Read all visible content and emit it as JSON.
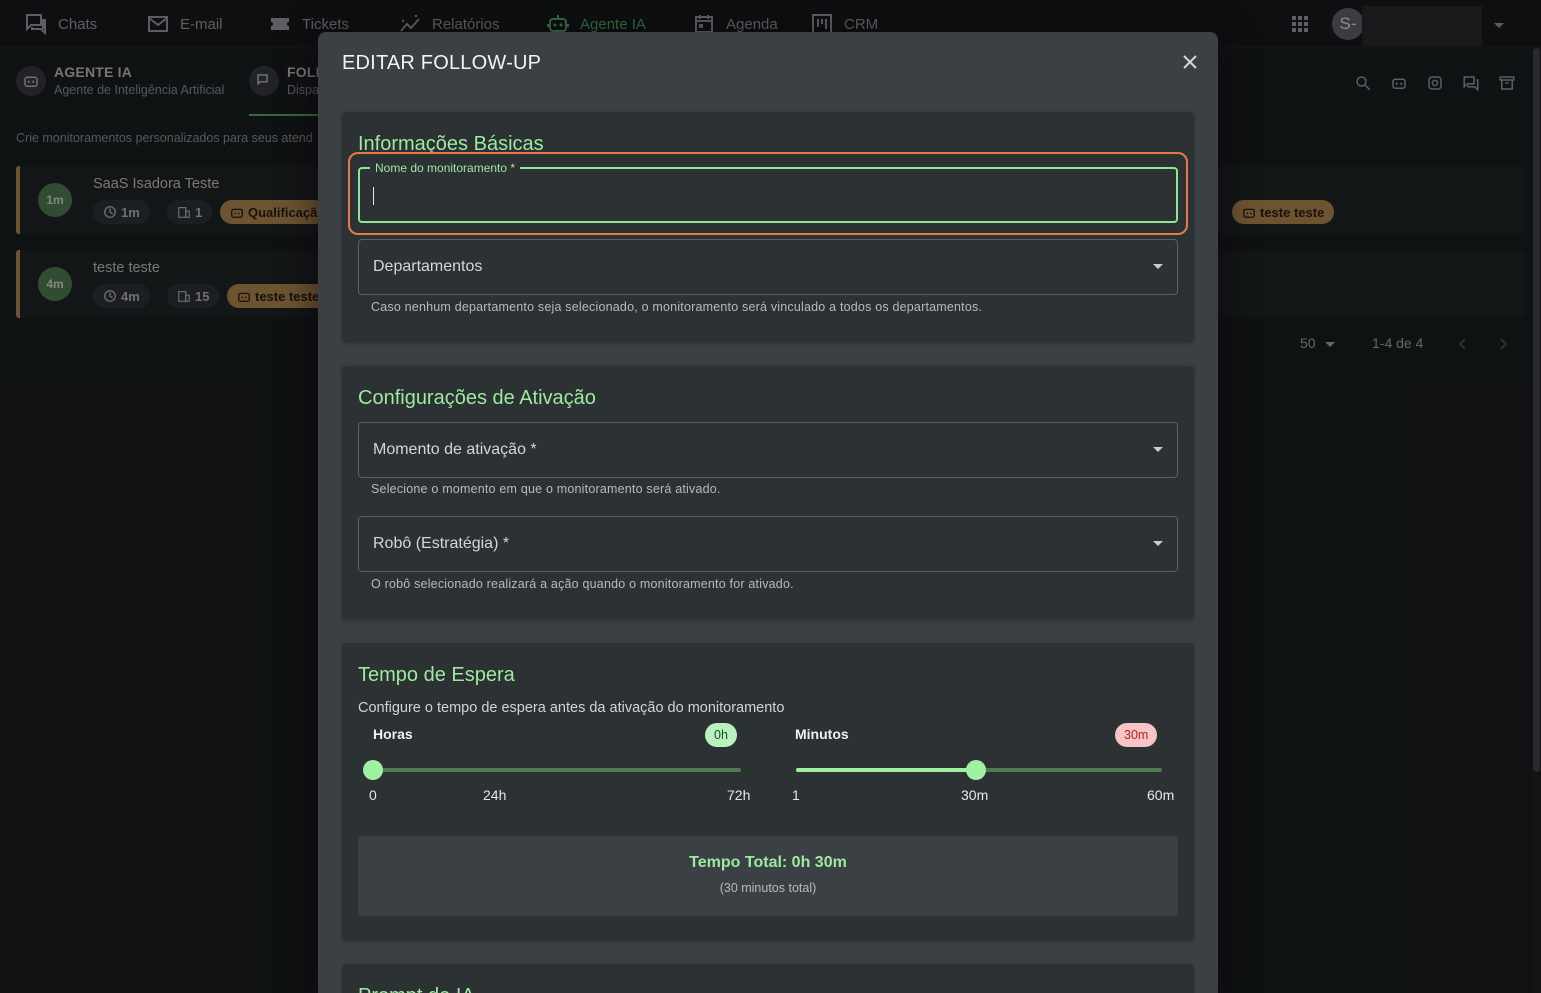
{
  "nav": {
    "items": [
      {
        "label": "Chats",
        "icon": "chat-icon"
      },
      {
        "label": "E-mail",
        "icon": "mail-icon"
      },
      {
        "label": "Tickets",
        "icon": "ticket-icon"
      },
      {
        "label": "Relatórios",
        "icon": "chart-icon"
      },
      {
        "label": "Agente IA",
        "icon": "robot-icon",
        "active": true
      },
      {
        "label": "Agenda",
        "icon": "calendar-icon"
      },
      {
        "label": "CRM",
        "icon": "kanban-icon"
      }
    ],
    "avatar_initial": "S-"
  },
  "background": {
    "tab1_title": "AGENTE IA",
    "tab1_sub": "Agente de Inteligência Artificial",
    "tab2_title": "FOLL",
    "tab2_sub": "Dispa",
    "description": "Crie monitoramentos personalizados para seus atend",
    "cards": [
      {
        "time": "1m",
        "name": "SaaS Isadora Teste",
        "chip_time": "1m",
        "chip_depts": "1",
        "chip_robot": "Qualificaçã",
        "chip_robot_right": "teste teste"
      },
      {
        "time": "4m",
        "name": "teste teste",
        "chip_time": "4m",
        "chip_depts": "15",
        "chip_robot": "teste teste"
      }
    ],
    "pagination": {
      "per_page": "50",
      "range": "1-4 de 4"
    }
  },
  "dialog": {
    "title": "EDITAR FOLLOW-UP",
    "basic": {
      "title": "Informações Básicas",
      "name_label": "Nome do monitoramento *",
      "name_value": "",
      "dept_label": "Departamentos",
      "dept_helper": "Caso nenhum departamento seja selecionado, o monitoramento será vinculado a todos os departamentos."
    },
    "activation": {
      "title": "Configurações de Ativação",
      "moment_label": "Momento de ativação *",
      "moment_helper": "Selecione o momento em que o monitoramento será ativado.",
      "robot_label": "Robô (Estratégia) *",
      "robot_helper": "O robô selecionado realizará a ação quando o monitoramento for ativado."
    },
    "wait": {
      "title": "Tempo de Espera",
      "subtitle": "Configure o tempo de espera antes da ativação do monitoramento",
      "hours_label": "Horas",
      "hours_badge": "0h",
      "hours_value": 0,
      "hours_min": 0,
      "hours_max": 72,
      "hours_ticks": [
        "0",
        "24h",
        "72h"
      ],
      "minutes_label": "Minutos",
      "minutes_badge": "30m",
      "minutes_value": 30,
      "minutes_min": 1,
      "minutes_max": 60,
      "minutes_ticks": [
        "1",
        "30m",
        "60m"
      ],
      "total_title": "Tempo Total: 0h 30m",
      "total_sub": "(30 minutos total)"
    },
    "prompt": {
      "title": "Prompt de IA"
    }
  }
}
